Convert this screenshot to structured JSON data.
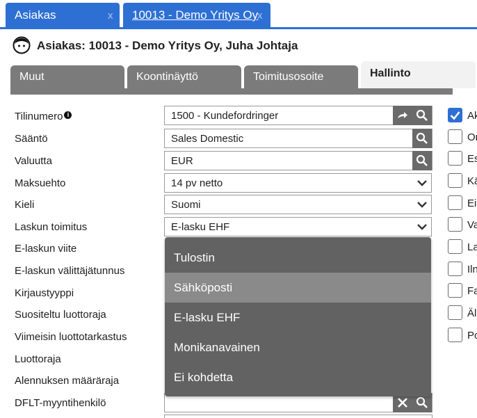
{
  "doc_tabs": [
    {
      "label": "Asiakas",
      "close": "x"
    },
    {
      "label": "10013 - Demo Yritys Oy",
      "close": "x"
    }
  ],
  "header": {
    "title": "Asiakas: 10013 - Demo Yritys Oy, Juha Johtaja",
    "avatar_icon": "user-face-icon"
  },
  "section_tabs": [
    {
      "label": "Muut"
    },
    {
      "label": "Koontinäyttö"
    },
    {
      "label": "Toimitusosoite"
    },
    {
      "label": "Hallinto",
      "active": true
    }
  ],
  "form": {
    "labels": {
      "tilinumero": "Tilinumero",
      "saanto": "Sääntö",
      "valuutta": "Valuutta",
      "maksuehto": "Maksuehto",
      "kieli": "Kieli",
      "laskun_toimitus": "Laskun toimitus",
      "elaskun_viite": "E-laskun viite",
      "elaskun_valittaja": "E-laskun välittäjätunnus",
      "kirjaustyyppi": "Kirjaustyyppi",
      "suositeltu_luottoraja": "Suositeltu luottoraja",
      "viimeisin_luottotarkastus": "Viimeisin luottotarkastus",
      "luottoraja": "Luottoraja",
      "alennuksen_maararaja": "Alennuksen määräraja",
      "dflt_myyntihenkilo": "DFLT-myyntihenkilö"
    },
    "values": {
      "tilinumero": "1500 - Kundefordringer",
      "saanto": "Sales Domestic",
      "valuutta": "EUR",
      "maksuehto": "14 pv netto",
      "kieli": "Suomi",
      "laskun_toimitus": "E-lasku EHF",
      "dflt_myyntihenkilo": ""
    },
    "info_icon": "i"
  },
  "dropdown": {
    "options": [
      "Tulostin",
      "Sähköposti",
      "E-lasku EHF",
      "Monikanavainen",
      "Ei kohdetta"
    ],
    "highlighted": "Sähköposti"
  },
  "checkboxes": [
    {
      "label": "Ak",
      "checked": true
    },
    {
      "label": "Or",
      "checked": false
    },
    {
      "label": "Es",
      "checked": false
    },
    {
      "label": "Kä",
      "checked": false
    },
    {
      "label": "Ei",
      "checked": false
    },
    {
      "label": "Va",
      "checked": false
    },
    {
      "label": "La",
      "checked": false
    },
    {
      "label": "Iln",
      "checked": false
    },
    {
      "label": "Fa",
      "checked": false
    },
    {
      "label": "Äl",
      "checked": false
    },
    {
      "label": "Po",
      "checked": false
    }
  ],
  "colors": {
    "accent": "#2e6fd4",
    "tab_gray": "#7b7b7b",
    "dropdown_bg": "#626262",
    "dropdown_highlight": "#8a8a8a"
  }
}
